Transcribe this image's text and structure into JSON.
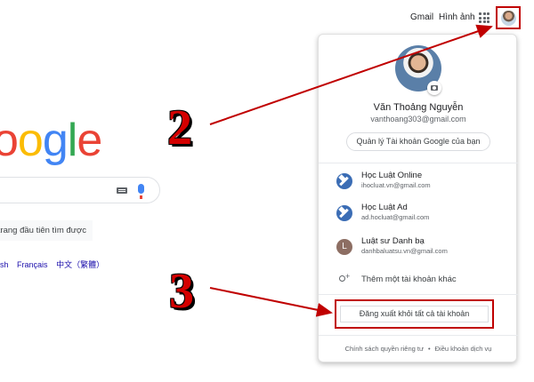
{
  "header": {
    "gmail": "Gmail",
    "images": "Hình ảnh",
    "apps_icon": "apps-grid-icon",
    "avatar_icon": "user-avatar-icon"
  },
  "logo": {
    "text_parts": [
      "o",
      "o",
      "g",
      "l",
      "e"
    ]
  },
  "search": {
    "keyboard_icon": "keyboard-icon",
    "mic_icon": "microphone-icon"
  },
  "lucky_button": "trang đầu tiên tìm được",
  "languages": [
    "sh",
    "Français",
    "中文（繁體）"
  ],
  "account_panel": {
    "name": "Văn Thoảng Nguyễn",
    "email": "vanthoang303@gmail.com",
    "manage_button": "Quản lý Tài khoản Google của bạn",
    "camera_icon": "camera-icon",
    "accounts": [
      {
        "name": "Học Luật Online",
        "email": "ihocluat.vn@gmail.com",
        "icon": "hammer-icon"
      },
      {
        "name": "Học Luật Ad",
        "email": "ad.hocluat@gmail.com",
        "icon": "hammer-icon"
      },
      {
        "name": "Luật sư Danh bạ",
        "email": "danhbaluatsu.vn@gmail.com",
        "letter": "L"
      }
    ],
    "add_account": "Thêm một tài khoản khác",
    "sign_out_all": "Đăng xuất khỏi tất cả tài khoản",
    "footer": {
      "privacy": "Chính sách quyền riêng tư",
      "separator": "•",
      "terms": "Điều khoản dịch vụ"
    }
  },
  "annotations": {
    "step2": "2",
    "step3": "3"
  },
  "colors": {
    "highlight": "#c00000",
    "annotation": "#d40000",
    "google_blue": "#4285f4",
    "google_red": "#ea4335",
    "google_yellow": "#fbbc05",
    "google_green": "#34a853"
  }
}
